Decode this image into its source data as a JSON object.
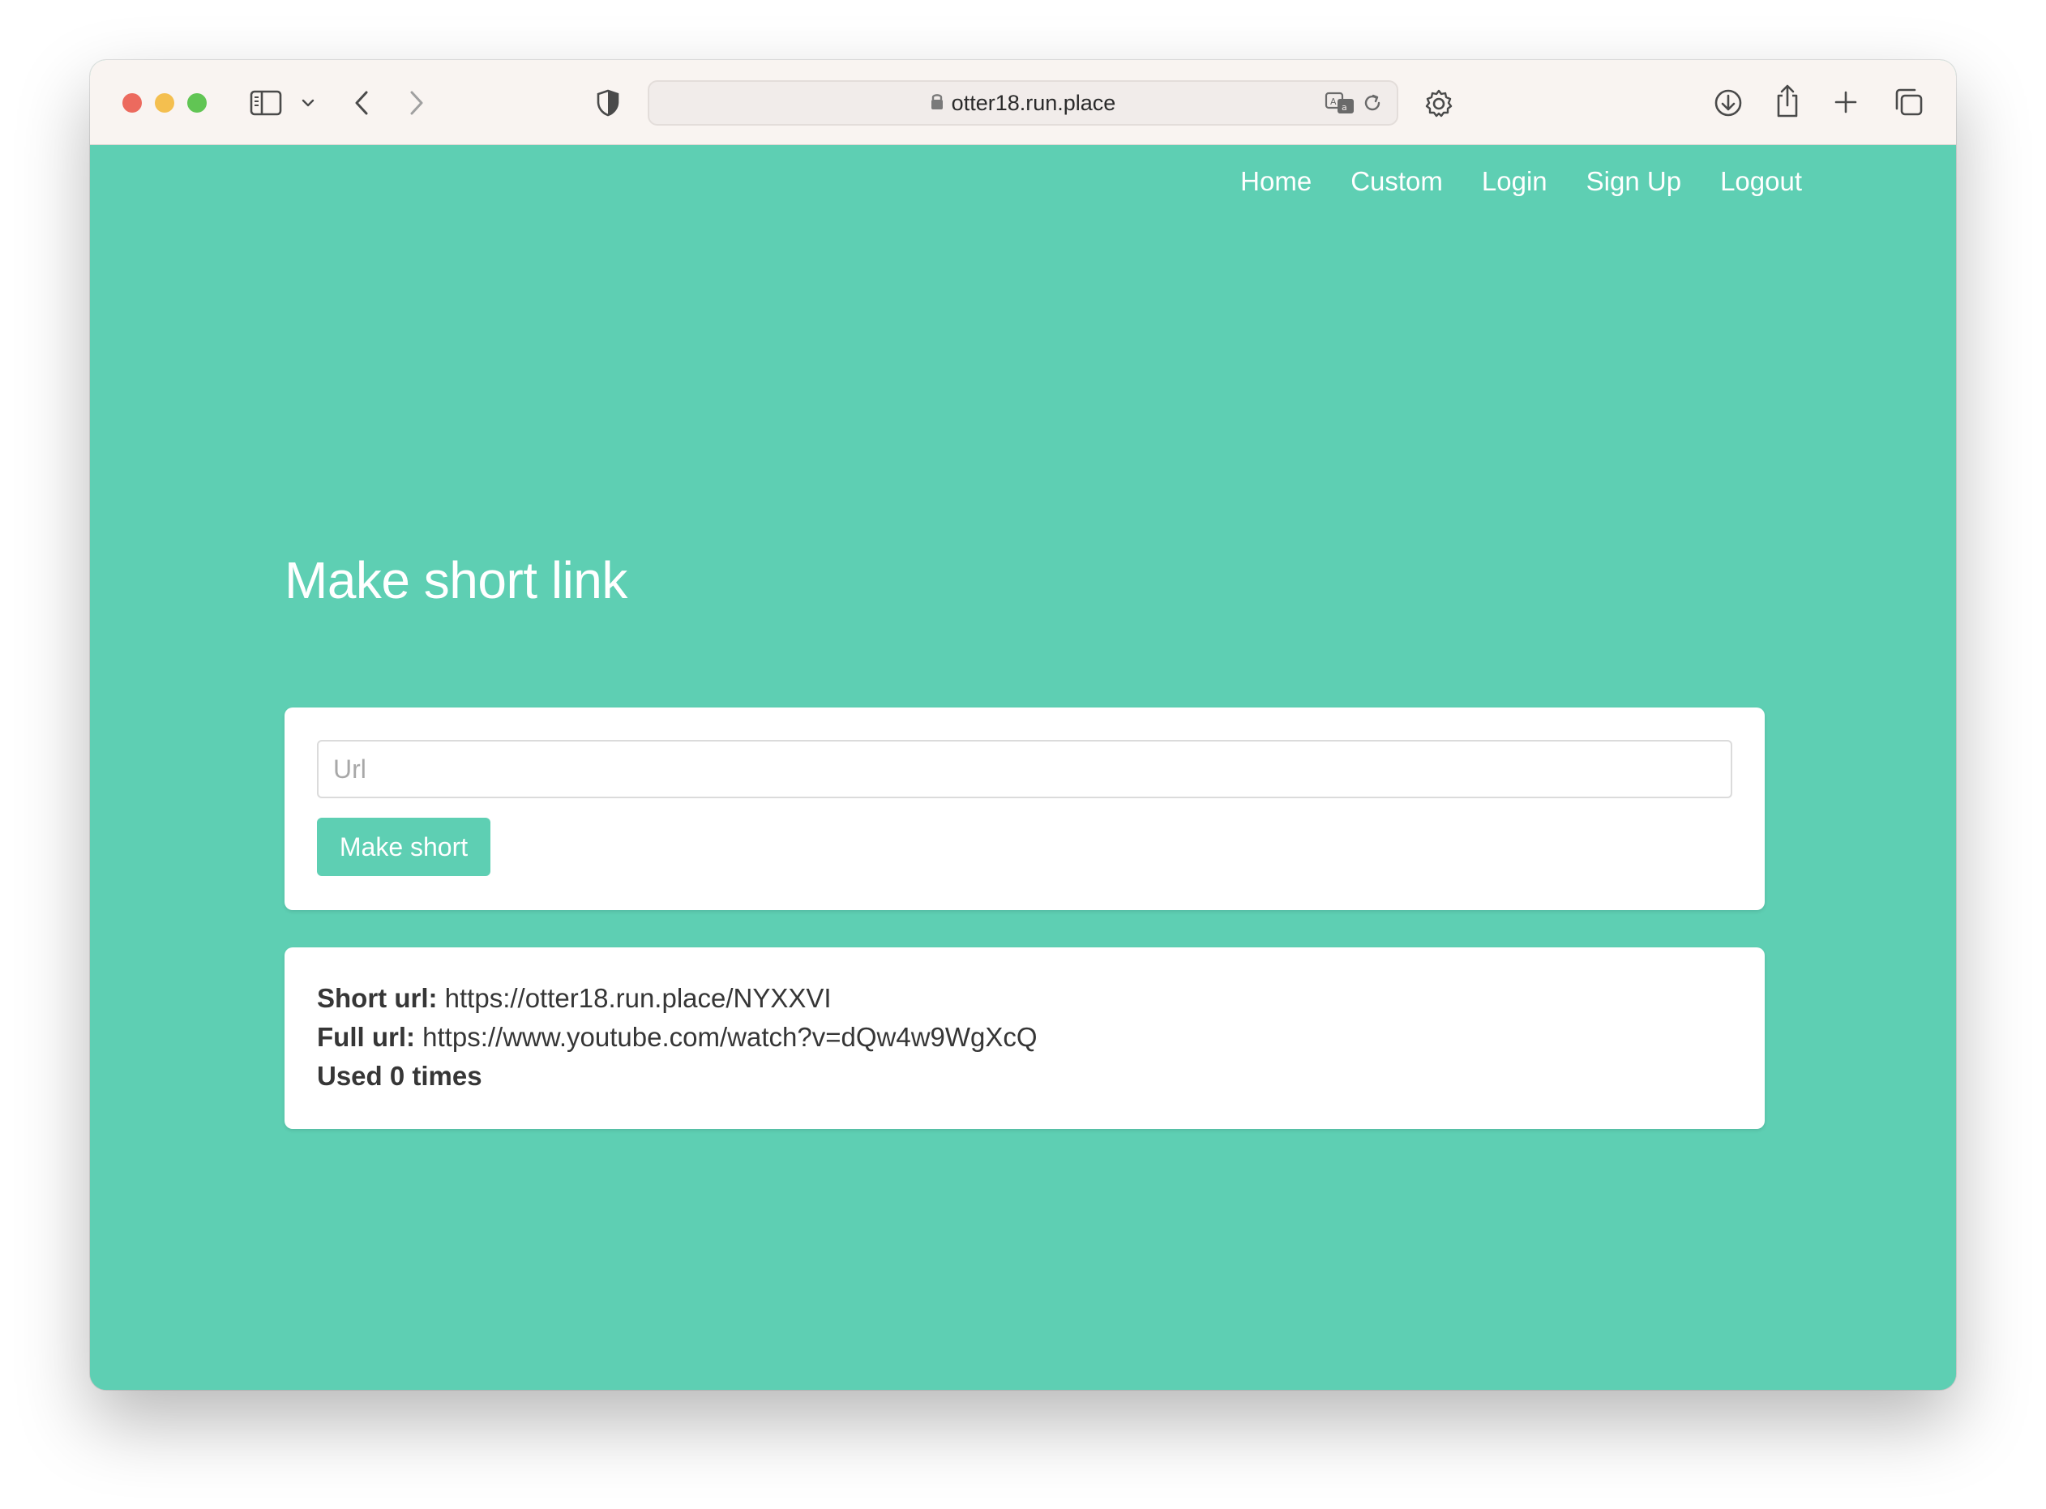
{
  "browser": {
    "address_url": "otter18.run.place"
  },
  "nav": {
    "items": [
      "Home",
      "Custom",
      "Login",
      "Sign Up",
      "Logout"
    ]
  },
  "main": {
    "heading": "Make short link",
    "form": {
      "url_placeholder": "Url",
      "url_value": "",
      "submit_label": "Make short"
    },
    "result": {
      "short_label": "Short url:",
      "short_value": "https://otter18.run.place/NYXXVI",
      "full_label": "Full url:",
      "full_value": "https://www.youtube.com/watch?v=dQw4w9WgXcQ",
      "used_text": "Used 0 times"
    }
  },
  "colors": {
    "accent": "#5ecfb3",
    "toolbar": "#f9f4f1",
    "card": "#ffffff",
    "text": "#363636"
  },
  "icons": [
    "sidebar-icon",
    "chevron-down-icon",
    "back-icon",
    "forward-icon",
    "shield-icon",
    "lock-icon",
    "translate-icon",
    "reload-icon",
    "gear-icon",
    "download-icon",
    "share-icon",
    "plus-icon",
    "tabs-icon"
  ]
}
